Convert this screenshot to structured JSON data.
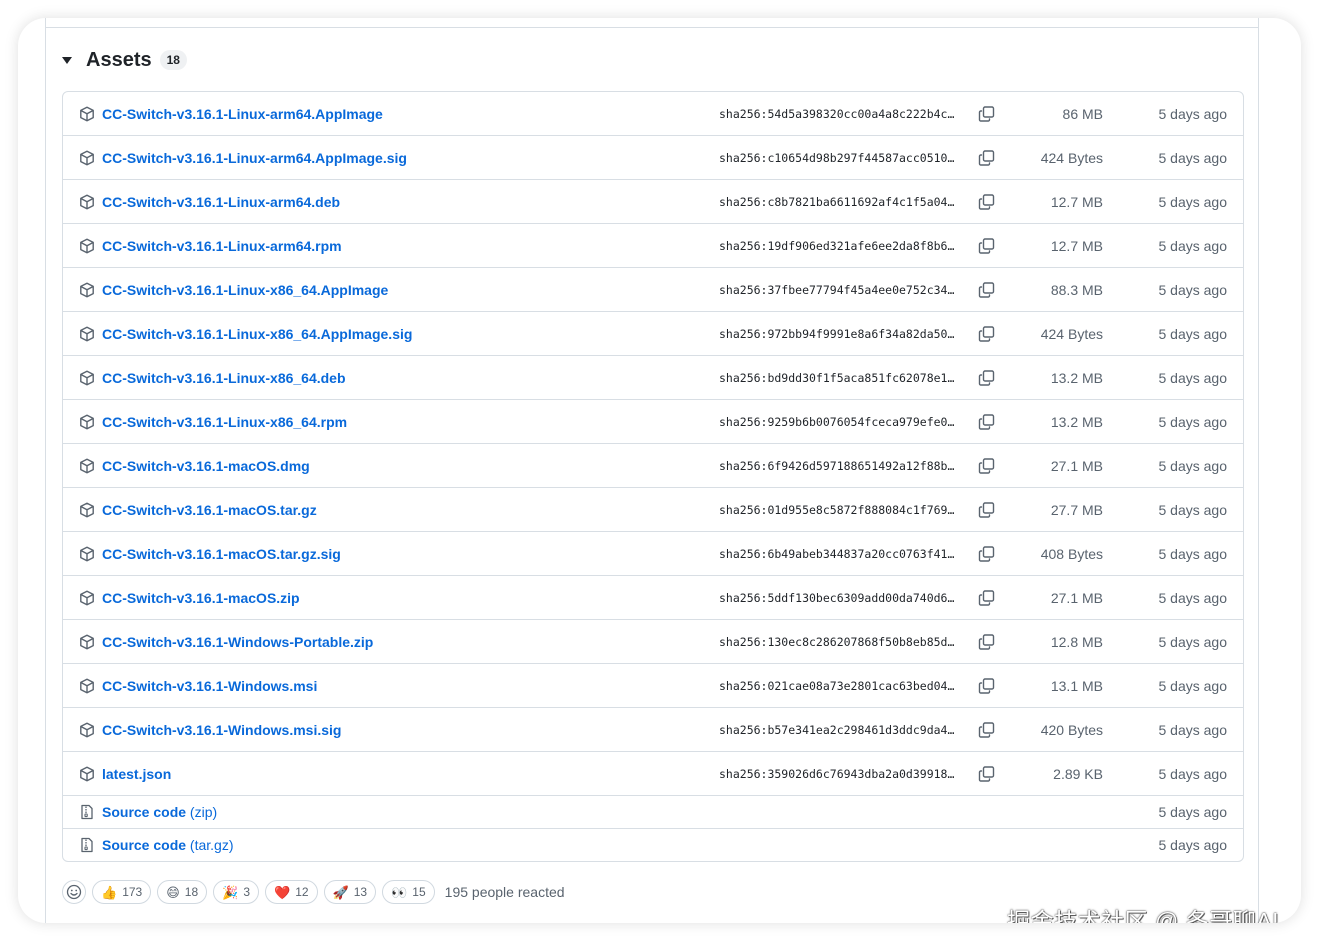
{
  "assets": {
    "title": "Assets",
    "count": "18",
    "files": [
      {
        "name": "CC-Switch-v3.16.1-Linux-arm64.AppImage",
        "sha": "sha256:54d5a398320cc00a4a8c222b4c…",
        "size": "86 MB",
        "date": "5 days ago"
      },
      {
        "name": "CC-Switch-v3.16.1-Linux-arm64.AppImage.sig",
        "sha": "sha256:c10654d98b297f44587acc0510…",
        "size": "424 Bytes",
        "date": "5 days ago"
      },
      {
        "name": "CC-Switch-v3.16.1-Linux-arm64.deb",
        "sha": "sha256:c8b7821ba6611692af4c1f5a04…",
        "size": "12.7 MB",
        "date": "5 days ago"
      },
      {
        "name": "CC-Switch-v3.16.1-Linux-arm64.rpm",
        "sha": "sha256:19df906ed321afe6ee2da8f8b6…",
        "size": "12.7 MB",
        "date": "5 days ago"
      },
      {
        "name": "CC-Switch-v3.16.1-Linux-x86_64.AppImage",
        "sha": "sha256:37fbee77794f45a4ee0e752c34…",
        "size": "88.3 MB",
        "date": "5 days ago"
      },
      {
        "name": "CC-Switch-v3.16.1-Linux-x86_64.AppImage.sig",
        "sha": "sha256:972bb94f9991e8a6f34a82da50…",
        "size": "424 Bytes",
        "date": "5 days ago"
      },
      {
        "name": "CC-Switch-v3.16.1-Linux-x86_64.deb",
        "sha": "sha256:bd9dd30f1f5aca851fc62078e1…",
        "size": "13.2 MB",
        "date": "5 days ago"
      },
      {
        "name": "CC-Switch-v3.16.1-Linux-x86_64.rpm",
        "sha": "sha256:9259b6b0076054fceca979efe0…",
        "size": "13.2 MB",
        "date": "5 days ago"
      },
      {
        "name": "CC-Switch-v3.16.1-macOS.dmg",
        "sha": "sha256:6f9426d597188651492a12f88b…",
        "size": "27.1 MB",
        "date": "5 days ago"
      },
      {
        "name": "CC-Switch-v3.16.1-macOS.tar.gz",
        "sha": "sha256:01d955e8c5872f888084c1f769…",
        "size": "27.7 MB",
        "date": "5 days ago"
      },
      {
        "name": "CC-Switch-v3.16.1-macOS.tar.gz.sig",
        "sha": "sha256:6b49abeb344837a20cc0763f41…",
        "size": "408 Bytes",
        "date": "5 days ago"
      },
      {
        "name": "CC-Switch-v3.16.1-macOS.zip",
        "sha": "sha256:5ddf130bec6309add00da740d6…",
        "size": "27.1 MB",
        "date": "5 days ago"
      },
      {
        "name": "CC-Switch-v3.16.1-Windows-Portable.zip",
        "sha": "sha256:130ec8c286207868f50b8eb85d…",
        "size": "12.8 MB",
        "date": "5 days ago"
      },
      {
        "name": "CC-Switch-v3.16.1-Windows.msi",
        "sha": "sha256:021cae08a73e2801cac63bed04…",
        "size": "13.1 MB",
        "date": "5 days ago"
      },
      {
        "name": "CC-Switch-v3.16.1-Windows.msi.sig",
        "sha": "sha256:b57e341ea2c298461d3ddc9da4…",
        "size": "420 Bytes",
        "date": "5 days ago"
      },
      {
        "name": "latest.json",
        "sha": "sha256:359026d6c76943dba2a0d39918…",
        "size": "2.89 KB",
        "date": "5 days ago"
      }
    ],
    "source": [
      {
        "label": "Source code",
        "suffix": "(zip)",
        "date": "5 days ago"
      },
      {
        "label": "Source code",
        "suffix": "(tar.gz)",
        "date": "5 days ago"
      }
    ]
  },
  "reactions": {
    "items": [
      {
        "emoji": "👍",
        "icon": "thumbs-up-icon",
        "count": "173"
      },
      {
        "emoji": "😄",
        "icon": "smile-icon",
        "count": "18"
      },
      {
        "emoji": "🎉",
        "icon": "party-icon",
        "count": "3"
      },
      {
        "emoji": "❤️",
        "icon": "heart-icon",
        "count": "12"
      },
      {
        "emoji": "🚀",
        "icon": "rocket-icon",
        "count": "13"
      },
      {
        "emoji": "👀",
        "icon": "eyes-icon",
        "count": "15"
      }
    ],
    "summary": "195 people reacted"
  },
  "watermark": "掘金技术社区 @ 冬哥聊AI",
  "colors": {
    "link": "#0969da",
    "border": "#d8dee4",
    "muted": "#59636e"
  }
}
